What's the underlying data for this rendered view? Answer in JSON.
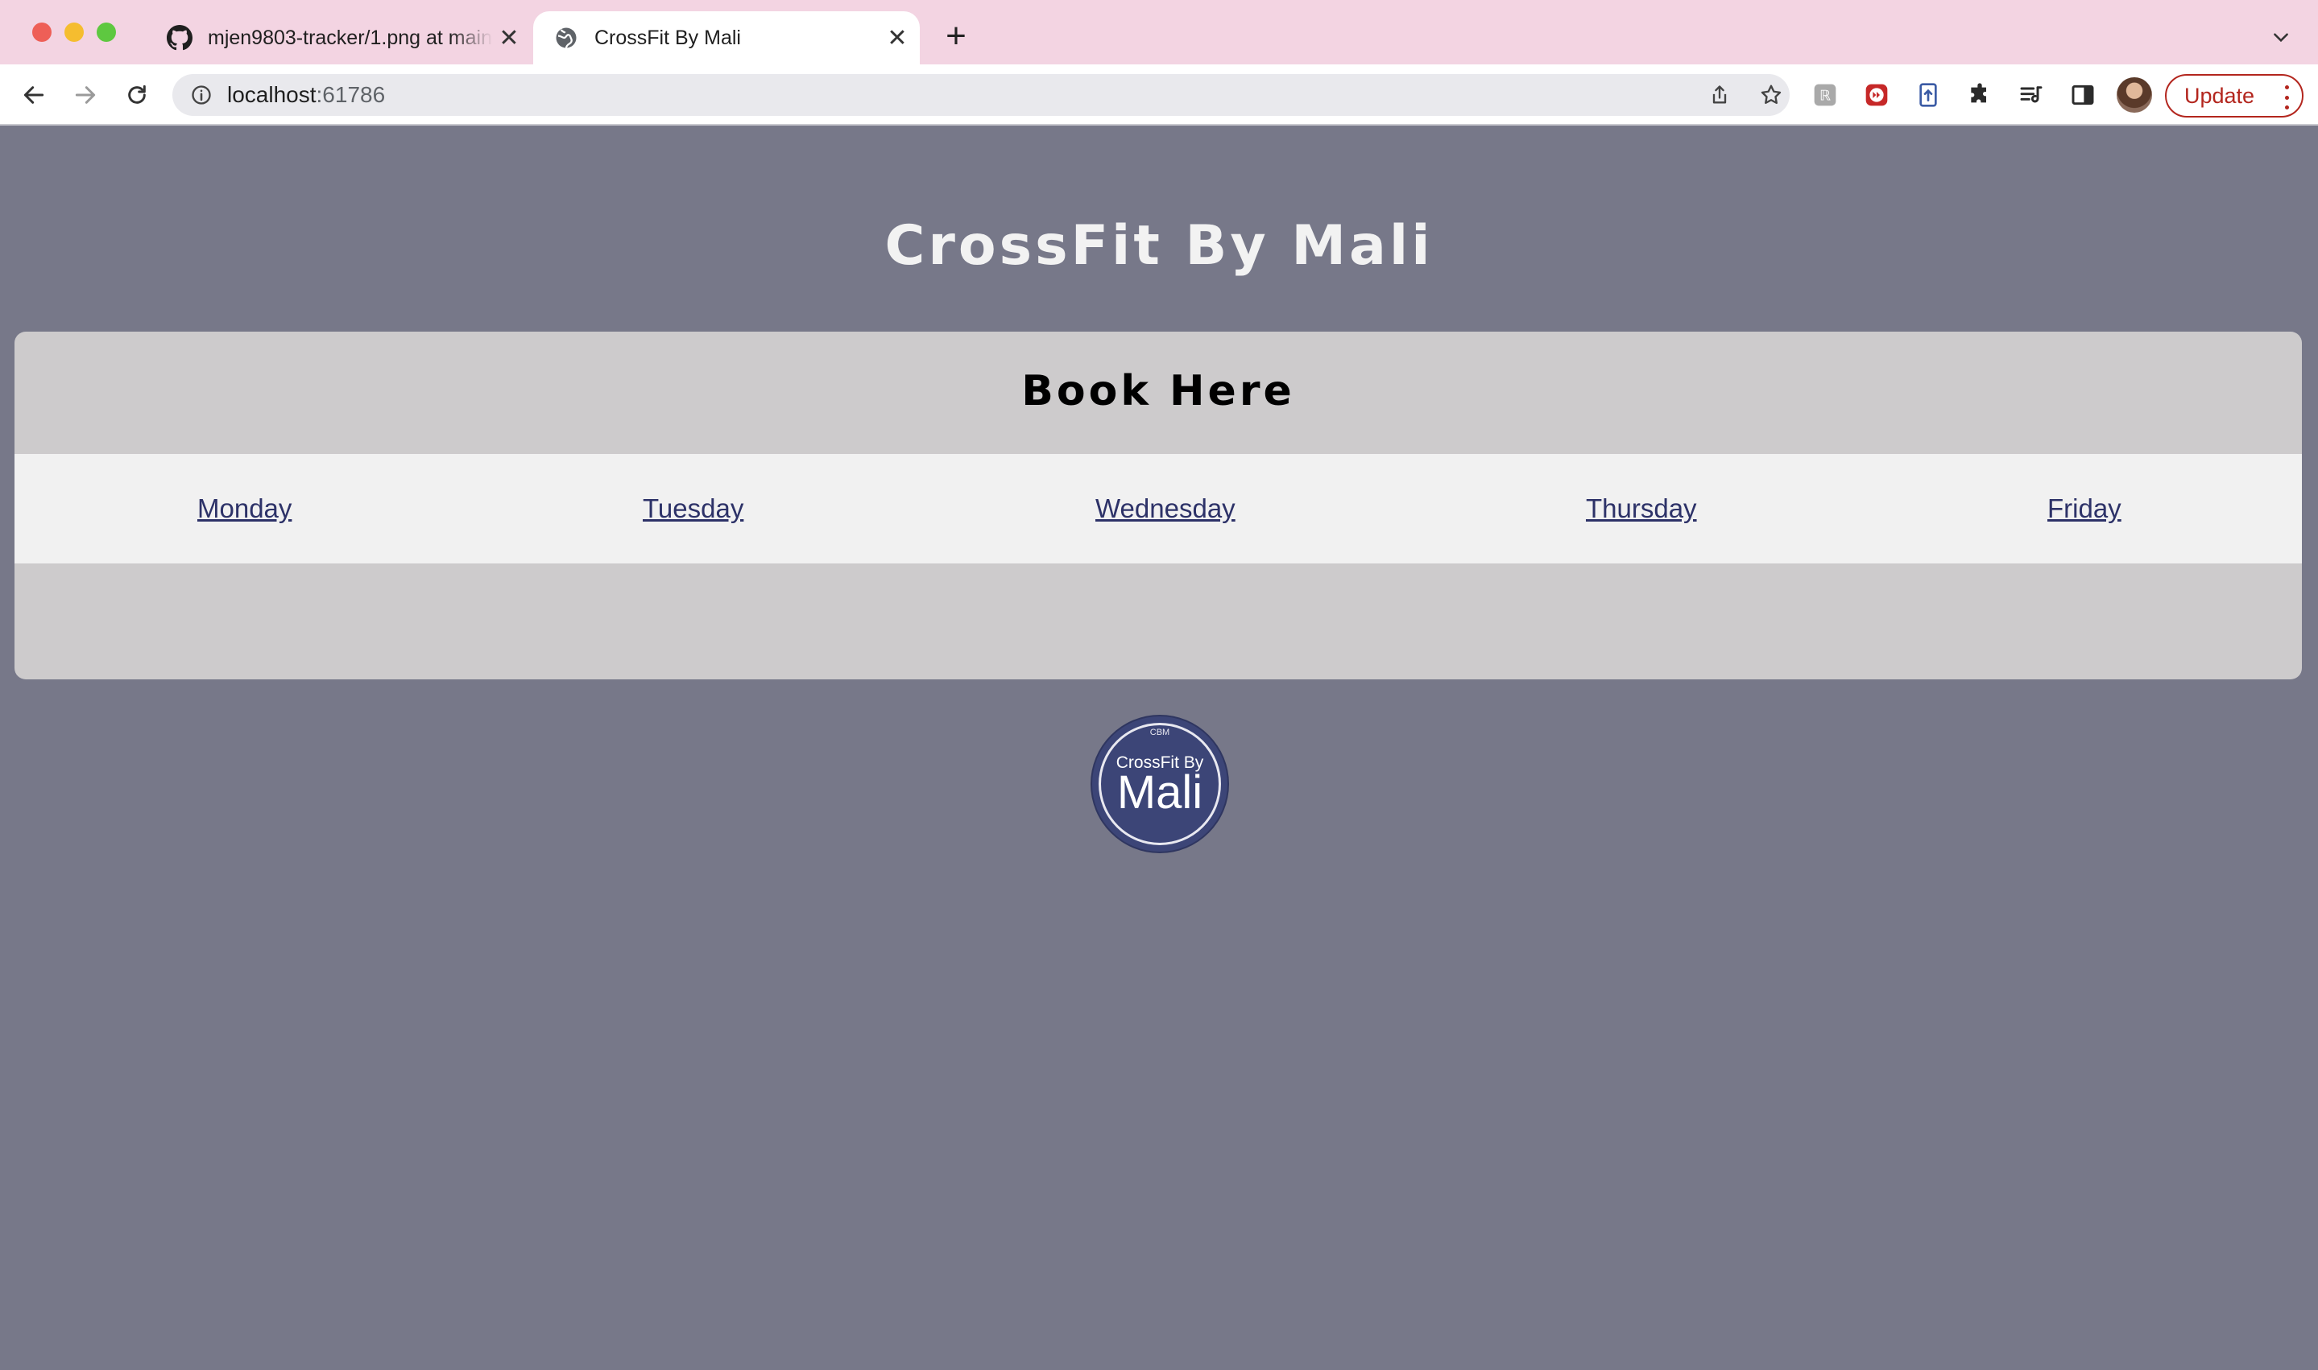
{
  "browser": {
    "tabs": [
      {
        "title": "mjen9803-tracker/1.png at main",
        "icon": "github-icon",
        "active": false
      },
      {
        "title": "CrossFit By Mali",
        "icon": "globe-icon",
        "active": true
      }
    ],
    "new_tab_label": "+",
    "address": {
      "host": "localhost",
      "port": ":61786"
    },
    "update_label": "Update"
  },
  "page": {
    "site_title": "CrossFit By Mali",
    "booking": {
      "heading": "Book Here",
      "days": [
        "Monday",
        "Tuesday",
        "Wednesday",
        "Thursday",
        "Friday"
      ]
    },
    "logo": {
      "small": "CBM",
      "mid": "CrossFit By",
      "big": "Mali"
    }
  },
  "colors": {
    "tab_bar": "#f3d4e2",
    "page_background": "#777889",
    "card_background": "#cdcbcc",
    "days_bar_background": "#f1f1f1",
    "link": "#2d3268",
    "logo_background": "#3c4577",
    "update_accent": "#b3261e"
  }
}
